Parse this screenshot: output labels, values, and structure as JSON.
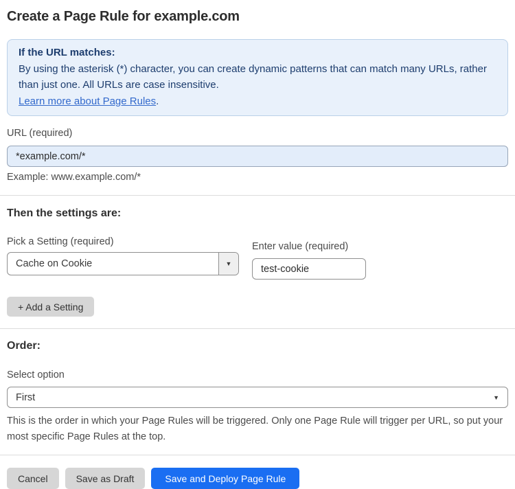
{
  "page": {
    "title": "Create a Page Rule for example.com"
  },
  "info_box": {
    "heading": "If the URL matches:",
    "body": "By using the asterisk (*) character, you can create dynamic patterns that can match many URLs, rather than just one. All URLs are case insensitive.",
    "link_label": "Learn more about Page Rules",
    "link_suffix": "."
  },
  "url_field": {
    "label": "URL (required)",
    "value": "*example.com/*",
    "helper": "Example: www.example.com/*"
  },
  "settings": {
    "heading": "Then the settings are:",
    "setting_select": {
      "label": "Pick a Setting (required)",
      "value": "Cache on Cookie"
    },
    "value_field": {
      "label": "Enter value (required)",
      "value": "test-cookie"
    },
    "add_button_label": "+ Add a Setting"
  },
  "order": {
    "heading": "Order:",
    "select_label": "Select option",
    "select_value": "First",
    "helper": "This is the order in which your Page Rules will be triggered. Only one Page Rule will trigger per URL, so put your most specific Page Rules at the top."
  },
  "actions": {
    "cancel_label": "Cancel",
    "save_draft_label": "Save as Draft",
    "deploy_label": "Save and Deploy Page Rule"
  },
  "icons": {
    "dropdown_arrow": "▼"
  },
  "colors": {
    "info_box_bg": "#e9f1fb",
    "info_box_border": "#bad0e8",
    "info_text": "#1d3d6e",
    "link_blue": "#3269cc",
    "url_input_bg": "#e3edfa",
    "primary_button": "#1a6ef2",
    "gray_button": "#d6d6d6"
  }
}
